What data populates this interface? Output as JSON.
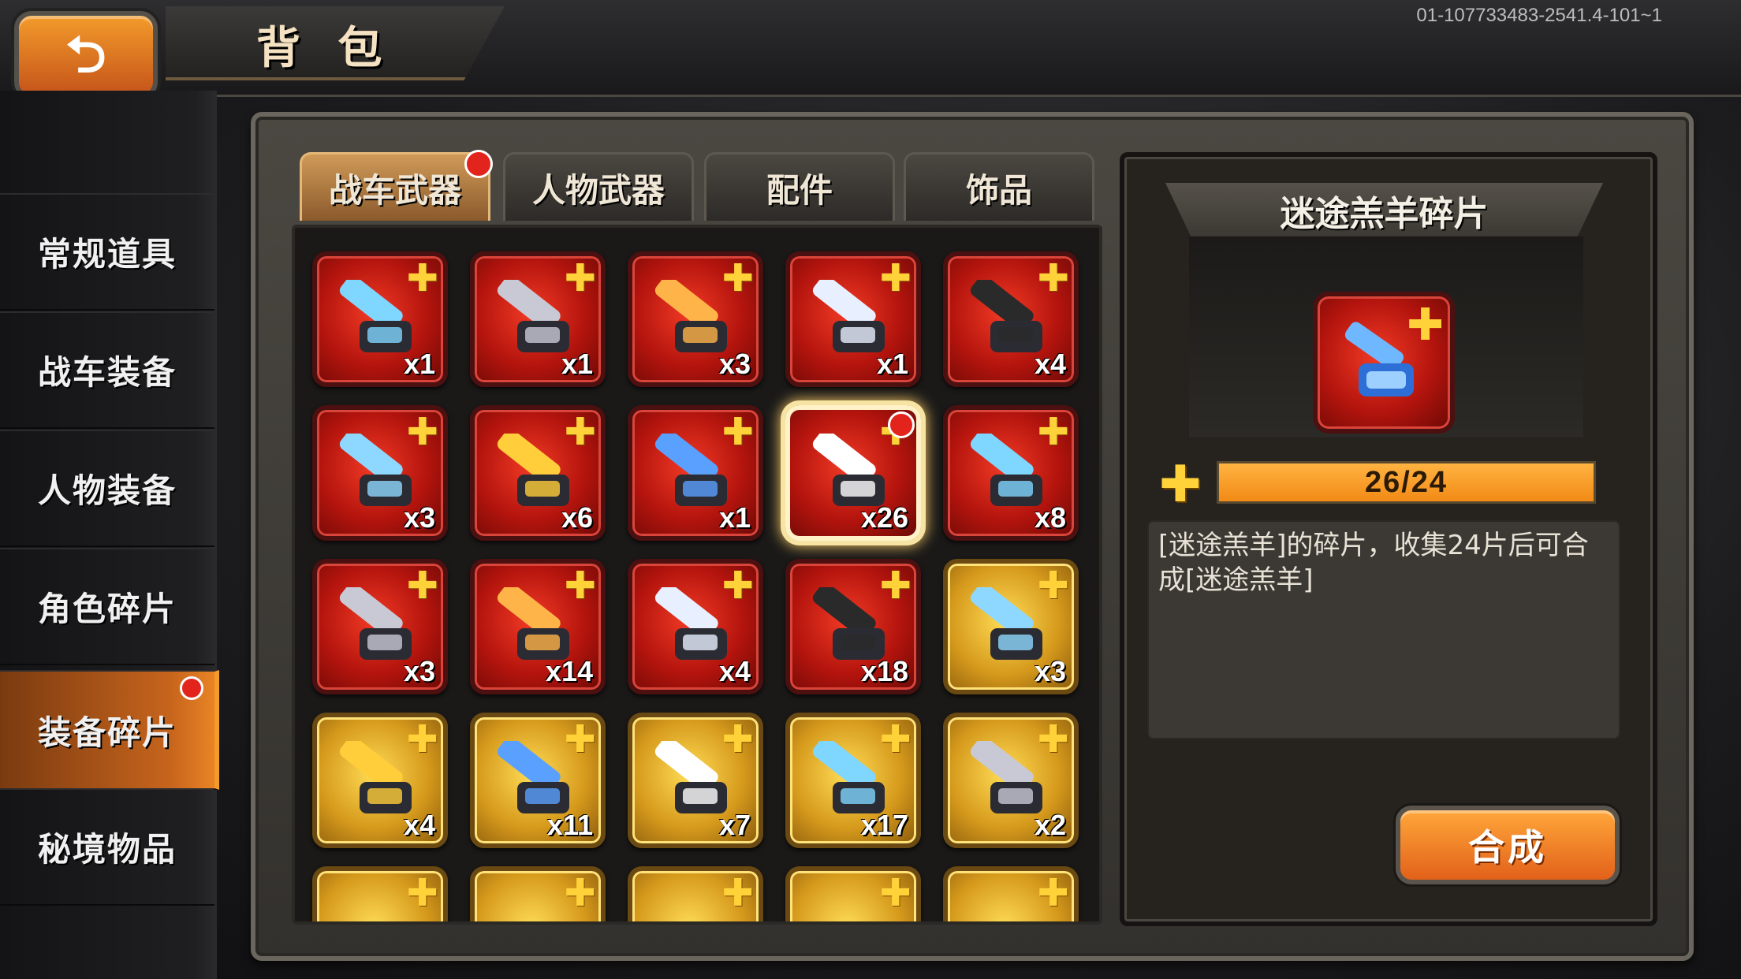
{
  "header": {
    "back_icon": "back-arrow-icon",
    "title": "背 包",
    "build_id": "01-107733483-2541.4-101~1"
  },
  "sidebar": {
    "items": [
      {
        "label": "常规道具",
        "active": false,
        "badge": false
      },
      {
        "label": "战车装备",
        "active": false,
        "badge": false
      },
      {
        "label": "人物装备",
        "active": false,
        "badge": false
      },
      {
        "label": "角色碎片",
        "active": false,
        "badge": false
      },
      {
        "label": "装备碎片",
        "active": true,
        "badge": true
      },
      {
        "label": "秘境物品",
        "active": false,
        "badge": false
      }
    ]
  },
  "tabs": [
    {
      "label": "战车武器",
      "active": true,
      "badge": true
    },
    {
      "label": "人物武器",
      "active": false,
      "badge": false
    },
    {
      "label": "配件",
      "active": false,
      "badge": false
    },
    {
      "label": "饰品",
      "active": false,
      "badge": false
    }
  ],
  "grid": {
    "rows": [
      [
        {
          "qty": "x1",
          "rarity": "red"
        },
        {
          "qty": "x1",
          "rarity": "red"
        },
        {
          "qty": "x3",
          "rarity": "red"
        },
        {
          "qty": "x1",
          "rarity": "red"
        },
        {
          "qty": "x4",
          "rarity": "red"
        }
      ],
      [
        {
          "qty": "x3",
          "rarity": "red"
        },
        {
          "qty": "x6",
          "rarity": "red"
        },
        {
          "qty": "x1",
          "rarity": "red"
        },
        {
          "qty": "x26",
          "rarity": "red",
          "selected": true,
          "badge": true
        },
        {
          "qty": "x8",
          "rarity": "red"
        }
      ],
      [
        {
          "qty": "x3",
          "rarity": "red"
        },
        {
          "qty": "x14",
          "rarity": "red"
        },
        {
          "qty": "x4",
          "rarity": "red"
        },
        {
          "qty": "x18",
          "rarity": "red"
        },
        {
          "qty": "x3",
          "rarity": "gold"
        }
      ],
      [
        {
          "qty": "x4",
          "rarity": "gold"
        },
        {
          "qty": "x11",
          "rarity": "gold"
        },
        {
          "qty": "x7",
          "rarity": "gold"
        },
        {
          "qty": "x17",
          "rarity": "gold"
        },
        {
          "qty": "x2",
          "rarity": "gold"
        }
      ]
    ]
  },
  "detail": {
    "title": "迷途羔羊碎片",
    "progress_text": "26/24",
    "progress_fraction": 1.0,
    "description": "[迷途羔羊]的碎片，收集24片后可合成[迷途羔羊]",
    "synthesize_label": "合成"
  },
  "colors": {
    "accent_orange": "#f39b2b",
    "rarity_red": "#c8170f",
    "rarity_gold": "#e0a52a",
    "badge_red": "#e3241c"
  }
}
